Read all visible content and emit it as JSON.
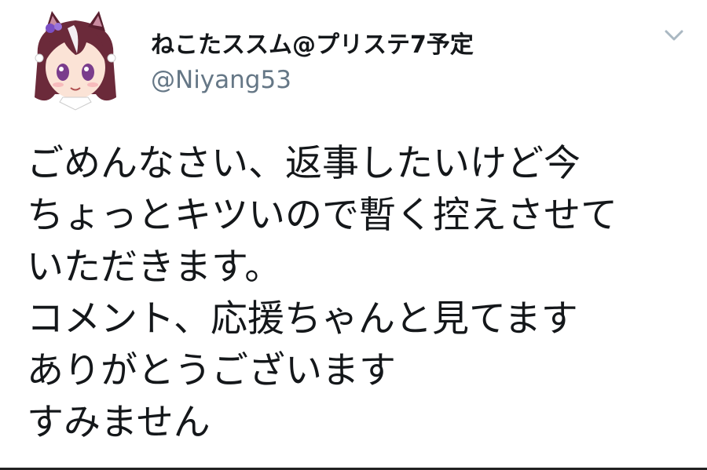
{
  "tweet": {
    "author": {
      "display_name": "ねこたススム@プリステ7予定",
      "handle": "@Niyang53",
      "avatar_icon": "anime-girl-avatar-icon"
    },
    "menu_icon": "chevron-down-icon",
    "body_lines": [
      "ごめんなさい、返事したいけど今",
      "ちょっとキツいので暫く控えさせて",
      "いただきます。",
      "コメント、応援ちゃんと見てます",
      "ありがとうございます",
      "すみません"
    ]
  },
  "colors": {
    "text": "#14171a",
    "secondary_text": "#657786",
    "caret": "#aab8c2",
    "background": "#ffffff"
  }
}
